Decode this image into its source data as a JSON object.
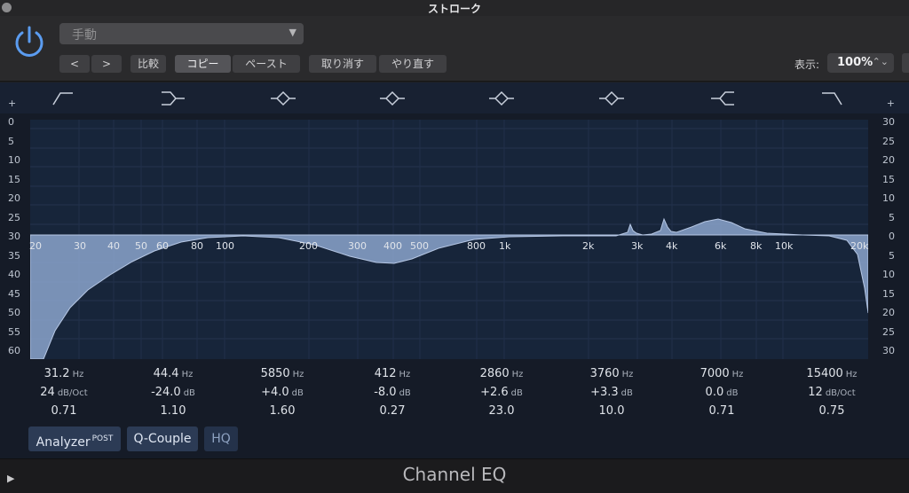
{
  "window": {
    "title": "ストローク"
  },
  "header": {
    "preset_value": "手動",
    "back_label": "<",
    "forward_label": ">",
    "compare_label": "比較",
    "copy_label": "コピー",
    "paste_label": "ペースト",
    "undo_label": "取り消す",
    "redo_label": "やり直す",
    "display_label": "表示:",
    "zoom_value": "100%"
  },
  "axes": {
    "left_plus": "+",
    "left": [
      "0",
      "5",
      "10",
      "15",
      "20",
      "25",
      "30",
      "35",
      "40",
      "45",
      "50",
      "55",
      "60"
    ],
    "right_plus": "+",
    "right": [
      "30",
      "25",
      "20",
      "15",
      "10",
      "5",
      "0",
      "5",
      "10",
      "15",
      "20",
      "25",
      "30"
    ],
    "freq": [
      "20",
      "30",
      "40",
      "50",
      "60",
      "80",
      "100",
      "200",
      "300",
      "400",
      "500",
      "800",
      "1k",
      "2k",
      "3k",
      "4k",
      "6k",
      "8k",
      "10k",
      "20k"
    ]
  },
  "bands": [
    {
      "icon": "low-cut-icon",
      "freq": "31.2",
      "freq_unit": "Hz",
      "gain": "24",
      "gain_unit": "dB/Oct",
      "q": "0.71"
    },
    {
      "icon": "low-shelf-icon",
      "freq": "44.4",
      "freq_unit": "Hz",
      "gain": "-24.0",
      "gain_unit": "dB",
      "q": "1.10"
    },
    {
      "icon": "bell-icon",
      "freq": "5850",
      "freq_unit": "Hz",
      "gain": "+4.0",
      "gain_unit": "dB",
      "q": "1.60"
    },
    {
      "icon": "bell-icon",
      "freq": "412",
      "freq_unit": "Hz",
      "gain": "-8.0",
      "gain_unit": "dB",
      "q": "0.27"
    },
    {
      "icon": "bell-icon",
      "freq": "2860",
      "freq_unit": "Hz",
      "gain": "+2.6",
      "gain_unit": "dB",
      "q": "23.0"
    },
    {
      "icon": "bell-icon",
      "freq": "3760",
      "freq_unit": "Hz",
      "gain": "+3.3",
      "gain_unit": "dB",
      "q": "10.0"
    },
    {
      "icon": "high-shelf-icon",
      "freq": "7000",
      "freq_unit": "Hz",
      "gain": "0.0",
      "gain_unit": "dB",
      "q": "0.71"
    },
    {
      "icon": "high-cut-icon",
      "freq": "15400",
      "freq_unit": "Hz",
      "gain": "12",
      "gain_unit": "dB/Oct",
      "q": "0.75"
    }
  ],
  "footer_buttons": {
    "analyzer_label": "Analyzer",
    "analyzer_sup": "POST",
    "qcouple_label": "Q-Couple",
    "hq_label": "HQ"
  },
  "plugin_name": "Channel EQ",
  "colors": {
    "power": "#5b9cf0",
    "curve_fill": "#8fa9d2",
    "curve_line": "#b6c7e4",
    "plot_bg": "#17253a"
  }
}
